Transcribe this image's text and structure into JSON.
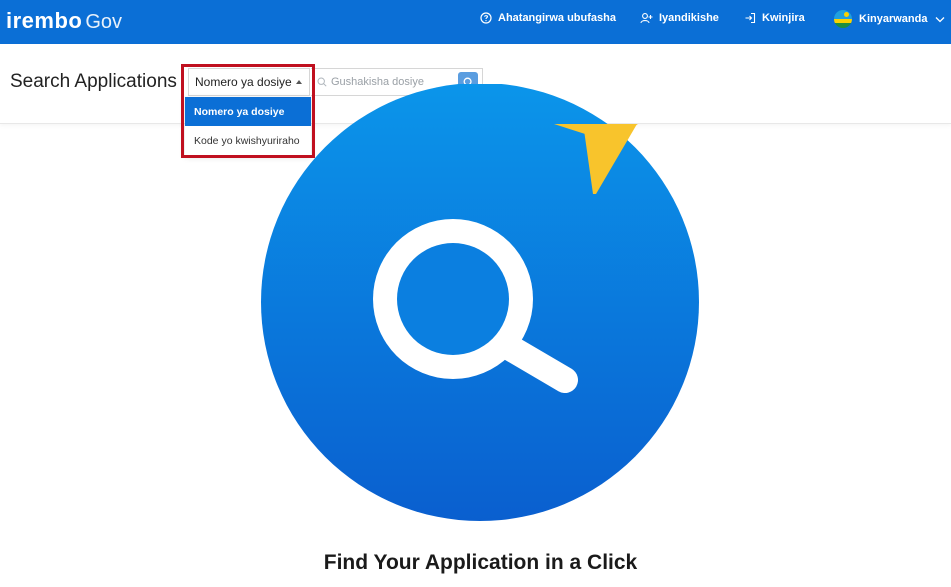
{
  "app": {
    "logo_main": "irembo",
    "logo_sub": "Gov"
  },
  "nav": {
    "help": "Ahatangirwa ubufasha",
    "register": "Iyandikishe",
    "login": "Kwinjira",
    "language": "Kinyarwanda"
  },
  "search": {
    "title": "Search Applications",
    "selected_type": "Nomero ya dosiye",
    "placeholder": "Gushakisha dosiye",
    "value": "",
    "options": [
      {
        "label": "Nomero ya dosiye",
        "selected": true
      },
      {
        "label": "Kode yo kwishyuriraho",
        "selected": false
      }
    ]
  },
  "hero": {
    "title": "Find Your Application in a Click"
  },
  "colors": {
    "brand": "#0b6fd6",
    "highlight": "#c0101f",
    "hero_circle_top": "#0b8fe6",
    "hero_circle_bottom": "#0a62d0",
    "lightning": "#f8c42c"
  }
}
